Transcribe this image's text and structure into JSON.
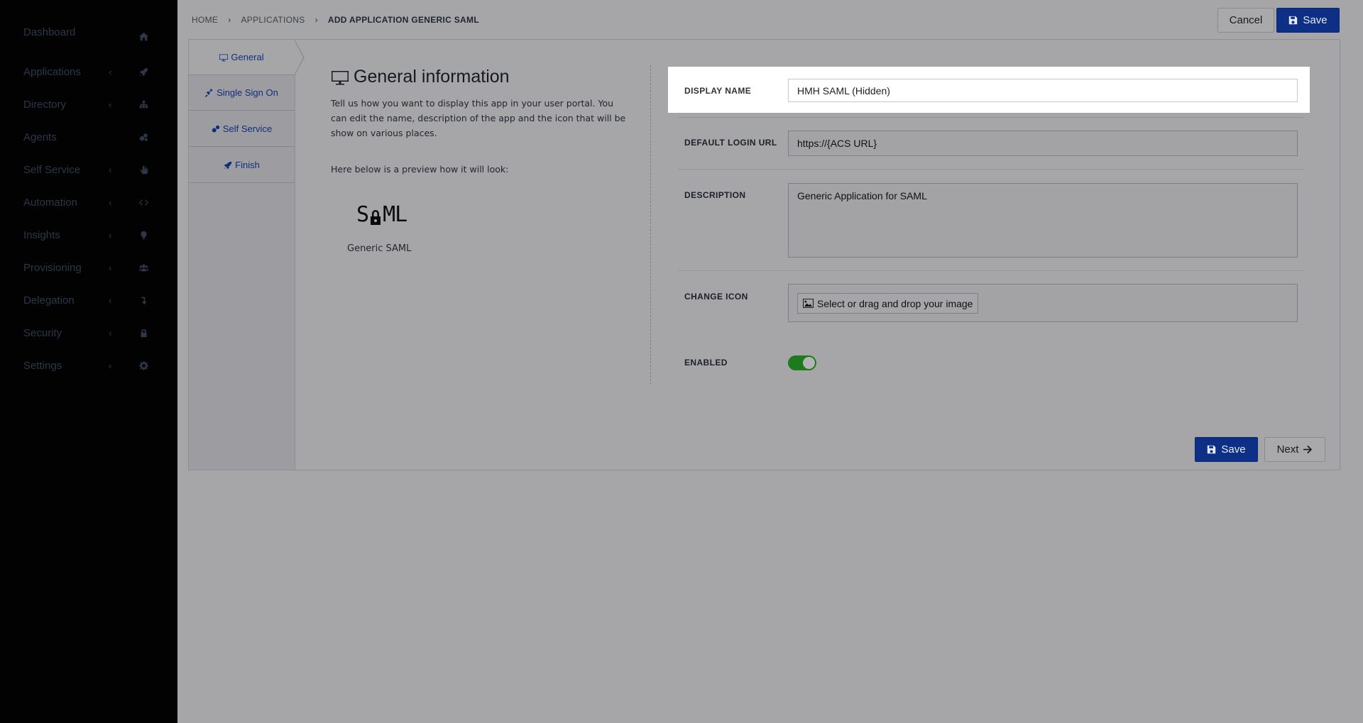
{
  "sidebar": {
    "items": [
      {
        "label": "Dashboard",
        "icon": "home-icon",
        "chevron": false
      },
      {
        "label": "Applications",
        "icon": "rocket-icon",
        "chevron": true
      },
      {
        "label": "Directory",
        "icon": "sitemap-icon",
        "chevron": true
      },
      {
        "label": "Agents",
        "icon": "cogs-icon",
        "chevron": false
      },
      {
        "label": "Self Service",
        "icon": "hand-icon",
        "chevron": true
      },
      {
        "label": "Automation",
        "icon": "code-icon",
        "chevron": true
      },
      {
        "label": "Insights",
        "icon": "lightbulb-icon",
        "chevron": true
      },
      {
        "label": "Provisioning",
        "icon": "users-icon",
        "chevron": true
      },
      {
        "label": "Delegation",
        "icon": "level-down-icon",
        "chevron": true
      },
      {
        "label": "Security",
        "icon": "lock-icon",
        "chevron": true
      },
      {
        "label": "Settings",
        "icon": "gear-icon",
        "chevron": true
      }
    ],
    "chevron_glyph": "‹"
  },
  "breadcrumb": {
    "items": [
      "HOME",
      "APPLICATIONS"
    ],
    "current": "ADD APPLICATION GENERIC SAML",
    "separator": "›"
  },
  "header": {
    "cancel_label": "Cancel",
    "save_label": "Save"
  },
  "wizard": {
    "steps": [
      {
        "label": "General",
        "icon": "desktop-icon",
        "active": true
      },
      {
        "label": "Single Sign On",
        "icon": "plug-icon",
        "active": false
      },
      {
        "label": "Self Service",
        "icon": "cogs-icon",
        "active": false
      },
      {
        "label": "Finish",
        "icon": "rocket-icon",
        "active": false
      }
    ]
  },
  "general": {
    "title": "General information",
    "description": "Tell us how you want to display this app in your user portal. You can edit the name, description of the app and the icon that will be show on various places.",
    "preview_label": "Here below is a preview how it will look:",
    "logo_text_left": "S",
    "logo_text_right": "ML",
    "app_name": "Generic SAML"
  },
  "form": {
    "display_name_label": "DISPLAY NAME",
    "display_name_value": "HMH SAML (Hidden)",
    "login_url_label": "DEFAULT LOGIN URL",
    "login_url_value": "https://{ACS URL}",
    "description_label": "DESCRIPTION",
    "description_value": "Generic Application for SAML",
    "change_icon_label": "CHANGE ICON",
    "change_icon_button": "Select or drag and drop your image",
    "enabled_label": "ENABLED",
    "enabled": true
  },
  "footer": {
    "save_label": "Save",
    "next_label": "Next"
  },
  "colors": {
    "primary": "#0d2f85",
    "toggle_on": "#1d7a1d",
    "sidebar_bg": "#020202",
    "overlay_bg": "#a6a6a8"
  }
}
